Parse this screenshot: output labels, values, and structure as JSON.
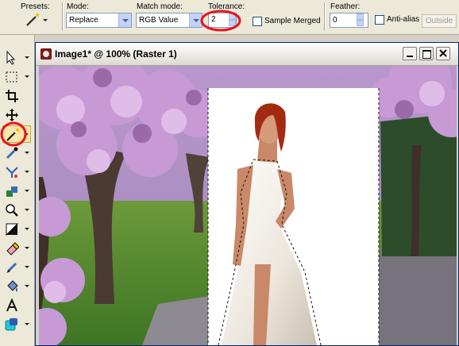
{
  "options": {
    "presets_label": "Presets:",
    "mode_label": "Mode:",
    "mode_value": "Replace",
    "match_mode_label": "Match mode:",
    "match_mode_value": "RGB Value",
    "tolerance_label": "Tolerance:",
    "tolerance_value": "2",
    "sample_merged_label": "Sample Merged",
    "sample_merged_checked": false,
    "feather_label": "Feather:",
    "feather_value": "0",
    "anti_alias_label": "Anti-alias",
    "anti_alias_checked": false,
    "outside_label": "Outside"
  },
  "tools": [
    {
      "name": "pick-tool",
      "icon": "arrow-pointer-icon"
    },
    {
      "name": "selection-tool",
      "icon": "dotted-rectangle-icon"
    },
    {
      "name": "crop-tool",
      "icon": "crop-icon"
    },
    {
      "name": "move-tool",
      "icon": "move-cross-icon"
    },
    {
      "name": "magic-wand-tool",
      "icon": "magic-wand-icon",
      "active": true
    },
    {
      "name": "dropper-tool",
      "icon": "dropper-icon"
    },
    {
      "name": "makeover-tool",
      "icon": "makeover-icon"
    },
    {
      "name": "clone-tool",
      "icon": "clone-icon"
    },
    {
      "name": "zoom-tool",
      "icon": "magnifier-icon"
    },
    {
      "name": "dodge-tool",
      "icon": "dodge-icon"
    },
    {
      "name": "eraser-tool",
      "icon": "eraser-icon"
    },
    {
      "name": "paint-brush-tool",
      "icon": "brush-icon"
    },
    {
      "name": "flood-fill-tool",
      "icon": "flood-fill-icon"
    },
    {
      "name": "text-tool",
      "icon": "text-a-icon"
    },
    {
      "name": "preset-shape-tool",
      "icon": "shape-icon"
    }
  ],
  "window": {
    "title": "Image1* @ 100% (Raster 1)"
  },
  "colors": {
    "annotation_red": "#e8141e",
    "titlebar_text": "#000000"
  }
}
